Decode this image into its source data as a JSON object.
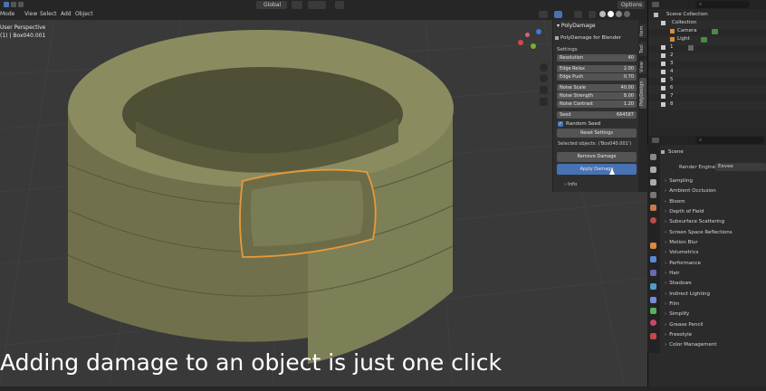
{
  "topbar": {
    "menu": [
      "Mode",
      "View",
      "Select",
      "Add",
      "Object"
    ],
    "transform_orientation": "Global",
    "options_label": "Options"
  },
  "viewport": {
    "view_name": "User Perspective",
    "collection_info": "(1) | Box040.001",
    "caption": "Adding damage to an object is just one click"
  },
  "npanel": {
    "panel_title": "PolyDamage",
    "addon_title": "PolyDamage for Blender",
    "settings_label": "Settings",
    "rows": [
      {
        "label": "Resolution",
        "value": "40"
      },
      {
        "label": "Edge Relax",
        "value": "2.00"
      },
      {
        "label": "Edge Push",
        "value": "0.70"
      },
      {
        "label": "Noise Scale",
        "value": "40.00"
      },
      {
        "label": "Noise Strength",
        "value": "8.00"
      },
      {
        "label": "Noise Contrast",
        "value": "1.20"
      },
      {
        "label": "Seed",
        "value": "664587"
      }
    ],
    "random_seed_label": "Random Seed",
    "reset_label": "Reset Settings",
    "selected_objects": "Selected objects: ('Box040.001')",
    "remove_label": "Remove Damage",
    "apply_label": "Apply Damage",
    "info_label": "Info",
    "tabs": [
      "Item",
      "Tool",
      "View",
      "PolyDesign"
    ]
  },
  "outliner": {
    "scene_collection": "Scene Collection",
    "collection": "Collection",
    "camera": "Camera",
    "light": "Light",
    "numbered_items": [
      "1",
      "2",
      "3",
      "4",
      "5",
      "6",
      "7",
      "8"
    ]
  },
  "properties": {
    "scene_label": "Scene",
    "render_engine_label": "Render Engine",
    "render_engine_value": "Eevee",
    "sections": [
      "Sampling",
      "Ambient Occlusion",
      "Bloom",
      "Depth of Field",
      "Subsurface Scattering",
      "Screen Space Reflections",
      "Motion Blur",
      "Volumetrics",
      "Performance",
      "Hair",
      "Shadows",
      "Indirect Lighting",
      "Film",
      "Simplify",
      "Grease Pencil",
      "Freestyle",
      "Color Management"
    ]
  },
  "colors": {
    "mesh": "#7a7c55",
    "selection": "#e59a3a",
    "apply_button": "#4772b3",
    "viewport_bg": "#393939"
  }
}
